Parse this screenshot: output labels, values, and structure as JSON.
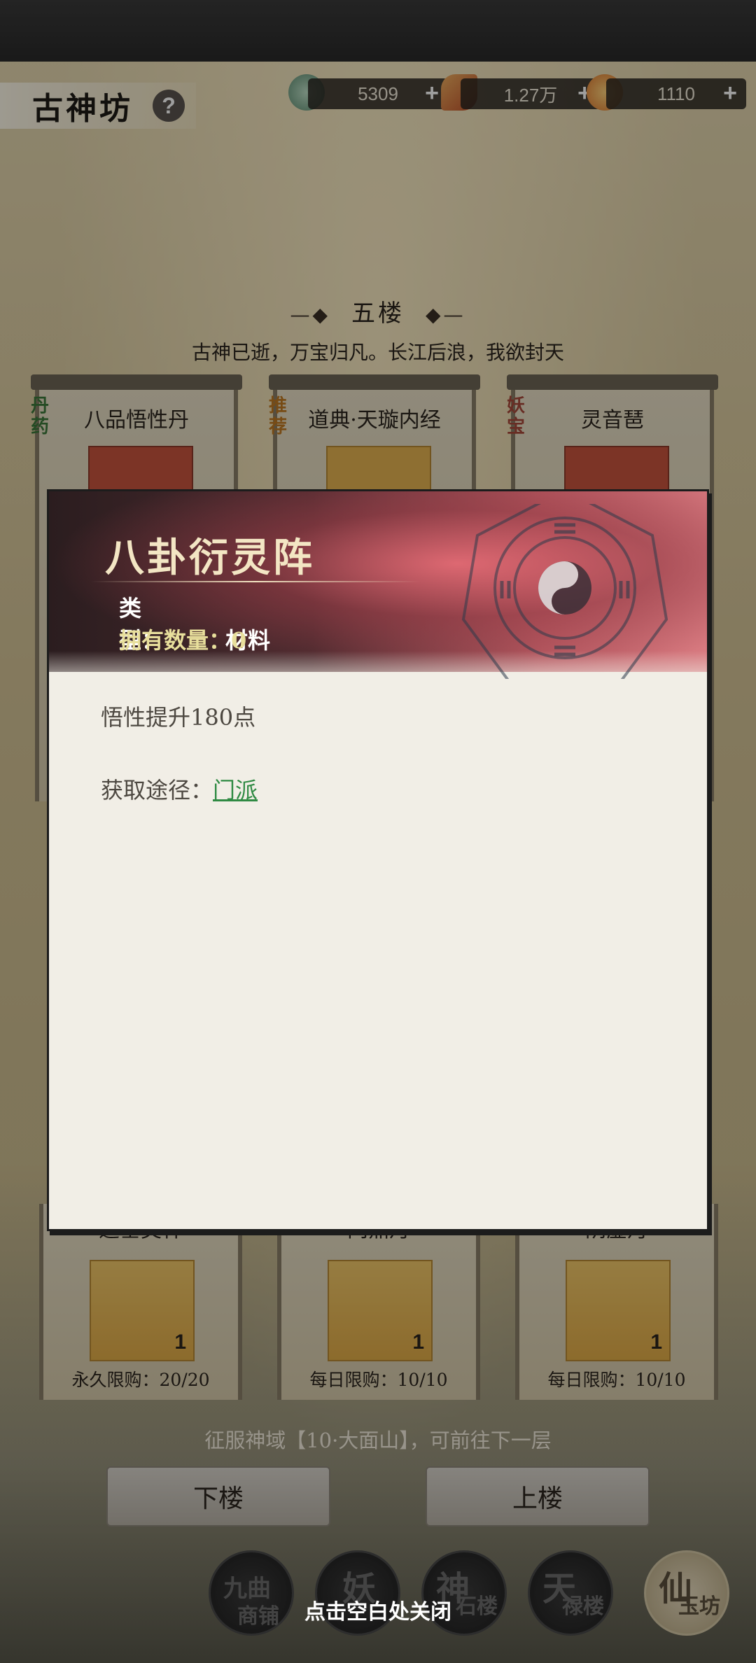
{
  "header": {
    "title": "古神坊",
    "help_icon": "question-icon",
    "currencies": [
      {
        "icon": "jade-coin-icon",
        "value": "5309"
      },
      {
        "icon": "feather-icon",
        "value": "1.27万"
      },
      {
        "icon": "lotus-flame-icon",
        "value": "1110"
      }
    ],
    "plus_label": "+"
  },
  "floor": {
    "name": "五楼",
    "motto": "古神已逝，万宝归凡。长江后浪，我欲封天",
    "condition": "征服神域【10·大面山】，可前往下一层",
    "down_label": "下楼",
    "up_label": "上楼"
  },
  "shop_top": [
    {
      "tag": "丹药",
      "name": "八品悟性丹",
      "tag_color": "#3d7a3a"
    },
    {
      "tag": "推荐",
      "name": "道典·天璇内经",
      "tag_color": "#c07a22"
    },
    {
      "tag": "妖宝",
      "name": "灵音琶",
      "tag_color": "#a84a3a"
    }
  ],
  "shop_bottom": [
    {
      "name": "道基灵种",
      "qty": "1",
      "limit": "永久限购：20/20"
    },
    {
      "name": "问鼎丹",
      "qty": "1",
      "limit": "每日限购：10/10"
    },
    {
      "name": "阴虚丹",
      "qty": "1",
      "limit": "每日限购：10/10"
    }
  ],
  "nav": [
    {
      "big": "九曲",
      "small": "商铺"
    },
    {
      "big": "妖",
      "small": ""
    },
    {
      "big": "神",
      "small": "石楼"
    },
    {
      "big": "天",
      "small": "禄楼"
    },
    {
      "big": "仙",
      "small": "玉坊"
    }
  ],
  "popup": {
    "item_name": "八卦衍灵阵",
    "type_label": "类　　型：",
    "type_value": "材料",
    "own_label": "拥有数量：",
    "own_value": "0",
    "description": "悟性提升180点",
    "source_label": "获取途径：",
    "source_link": "门派",
    "emblem": "bagua-icon"
  },
  "close_hint": "点击空白处关闭",
  "colors": {
    "popup_bg": "#f1eee6",
    "popup_header": "#4a2a2e",
    "link": "#2f8a43",
    "own_text": "#e8df9c"
  }
}
